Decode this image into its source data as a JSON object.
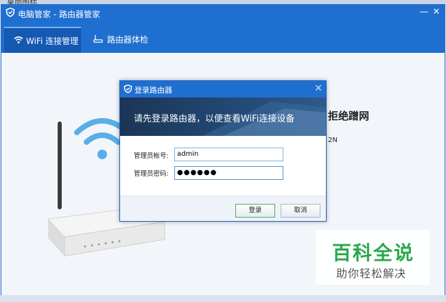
{
  "background": {
    "top_text": "桌面图标"
  },
  "window": {
    "title": "电脑管家 - 路由器管家",
    "minimize_glyph": "—",
    "close_glyph": "✕",
    "tabs": [
      {
        "label": "WiFi 连接管理",
        "icon": "wifi-icon",
        "active": true
      },
      {
        "label": "路由器体检",
        "icon": "router-check-icon",
        "active": false
      }
    ],
    "content": {
      "partial_heading": "拒绝蹭网",
      "partial_model": "2N"
    }
  },
  "dialog": {
    "title": "登录路由器",
    "close_glyph": "✕",
    "banner": "请先登录路由器，以便查看WiFi连接设备",
    "username_label": "管理员帐号:",
    "username_value": "admin",
    "password_label": "管理员密码:",
    "password_masked": "●●●●●●",
    "login_button": "登录",
    "cancel_button": "取消"
  },
  "watermark": {
    "title": "百科全说",
    "subtitle": "助你轻松解决"
  },
  "colors": {
    "titlebar": "#1f6fd0",
    "login_border": "#53a65c",
    "watermark_green": "#2aa84a"
  }
}
